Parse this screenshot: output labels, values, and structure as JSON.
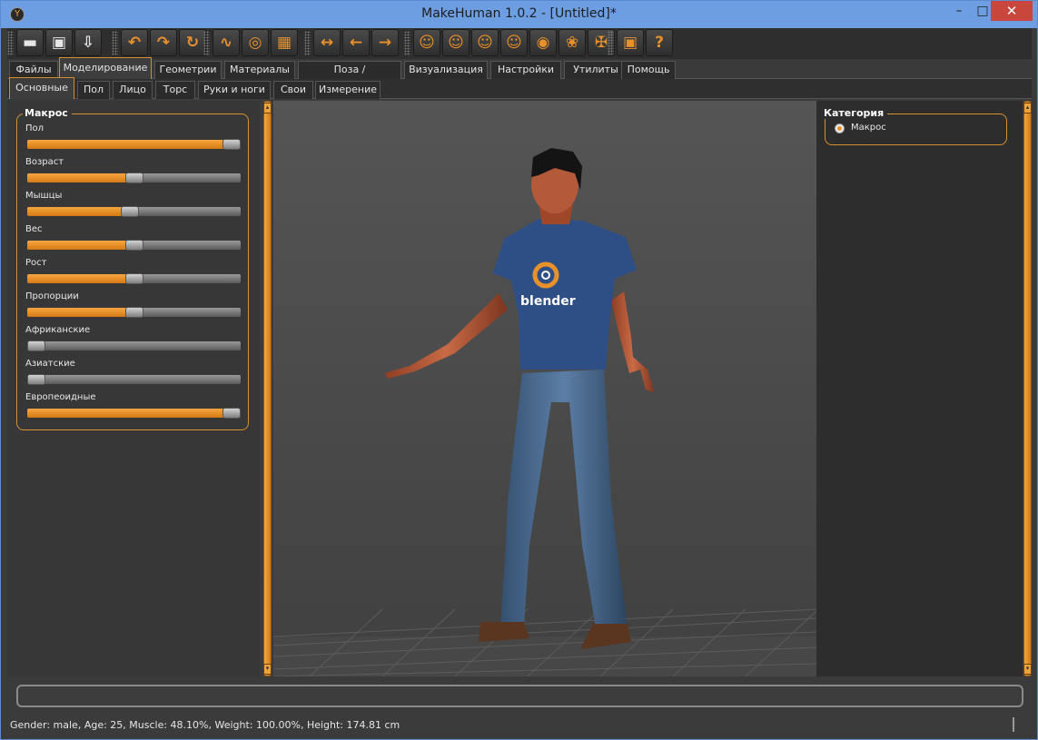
{
  "window": {
    "title": "MakeHuman 1.0.2 - [Untitled]*",
    "min_glyph": "–",
    "max_glyph": "□",
    "close_glyph": "✕"
  },
  "toolbar": {
    "groups": [
      [
        "▬",
        "▣",
        "⇩"
      ],
      [
        "↶",
        "↷",
        "↻"
      ],
      [
        "∿",
        "◎",
        "▦"
      ],
      [
        "↔",
        "←",
        "→"
      ],
      [
        "☺",
        "☺",
        "☺",
        "☺",
        "◉",
        "❀",
        "✠"
      ],
      [
        "▣",
        "?"
      ]
    ]
  },
  "main_tabs": [
    "Файлы",
    "Моделирование",
    "Геометрии",
    "Материалы",
    "Поза / Анимировать",
    "Визуализация",
    "Настройки",
    "Утилиты",
    "Помощь"
  ],
  "sub_tabs": [
    "Основные",
    "Пол",
    "Лицо",
    "Торс",
    "Руки и ноги",
    "Свои",
    "Измерение"
  ],
  "macro": {
    "title": "Макрос",
    "sliders": [
      {
        "label": "Пол",
        "value": 1.0
      },
      {
        "label": "Возраст",
        "value": 0.5
      },
      {
        "label": "Мышцы",
        "value": 0.481
      },
      {
        "label": "Вес",
        "value": 0.5
      },
      {
        "label": "Рост",
        "value": 0.5
      },
      {
        "label": "Пропорции",
        "value": 0.5
      },
      {
        "label": "Африканские",
        "value": 0.0
      },
      {
        "label": "Азиатские",
        "value": 0.0
      },
      {
        "label": "Европеоидные",
        "value": 1.0
      }
    ]
  },
  "category": {
    "title": "Категория",
    "option": "Макрос",
    "selected": true
  },
  "model": {
    "shirt_text": "blender",
    "shirt_color": "#2e4f86",
    "jeans_color": "#3c587e",
    "skin_color": "#b45a3a"
  },
  "status_bar": "Gender: male, Age: 25, Muscle: 48.10%, Weight: 100.00%, Height: 174.81 cm",
  "colors": {
    "accent": "#e8902a",
    "panel": "#373737",
    "viewport": "#4a4a4a"
  }
}
